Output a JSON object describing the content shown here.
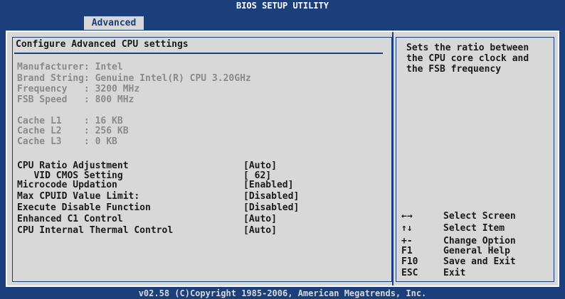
{
  "header": {
    "title": "BIOS SETUP UTILITY",
    "active_tab": "Advanced"
  },
  "section": {
    "title": "Configure Advanced CPU settings"
  },
  "info": [
    "Manufacturer: Intel",
    "Brand String: Genuine Intel(R) CPU 3.20GHz",
    "Frequency   : 3200 MHz",
    "FSB Speed   : 800 MHz",
    "Cache L1    : 16 KB",
    "Cache L2    : 256 KB",
    "Cache L3    : 0 KB"
  ],
  "settings": [
    {
      "label": "CPU Ratio Adjustment",
      "value": "[Auto]"
    },
    {
      "label": "   VID CMOS Setting",
      "value": "[ 62]"
    },
    {
      "label": "Microcode Updation",
      "value": "[Enabled]"
    },
    {
      "label": "Max CPUID Value Limit:",
      "value": "[Disabled]"
    },
    {
      "label": "Execute Disable Function",
      "value": "[Disabled]"
    },
    {
      "label": "Enhanced C1 Control",
      "value": "[Auto]"
    },
    {
      "label": "CPU Internal Thermal Control",
      "value": "[Auto]"
    }
  ],
  "help_text": "Sets the ratio between the CPU core clock and the FSB frequency",
  "keys": [
    {
      "key": "←→",
      "desc": "Select Screen",
      "icon": "left-right-arrows-icon"
    },
    {
      "key": "↑↓",
      "desc": "Select Item",
      "icon": "up-down-arrows-icon"
    },
    {
      "key": "+-",
      "desc": "Change Option"
    },
    {
      "key": "F1",
      "desc": "General Help"
    },
    {
      "key": "F10",
      "desc": "Save and Exit"
    },
    {
      "key": "ESC",
      "desc": "Exit"
    }
  ],
  "footer": "v02.58 (C)Copyright 1985-2006, American Megatrends, Inc.",
  "colors": {
    "background": "#1a3f7a",
    "panel": "#d8d8d8",
    "text": "#1a1a1a",
    "disabled_text": "#8a8a8a"
  }
}
